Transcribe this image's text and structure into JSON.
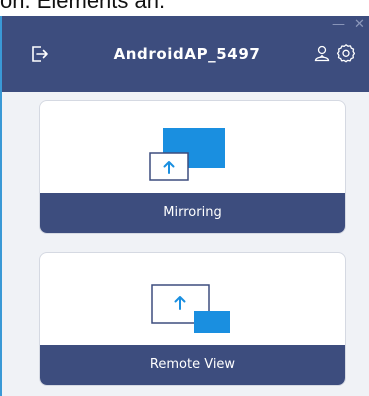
{
  "top_fragment": "on. Elements an.",
  "window_controls": {
    "minimize": "—",
    "close": "✕"
  },
  "header": {
    "title": "AndroidAP_5497",
    "icons": [
      "exit-icon",
      "user-icon",
      "gear-icon"
    ]
  },
  "cards": [
    {
      "id": "mirroring",
      "label": "Mirroring",
      "icon": "mirroring-icon"
    },
    {
      "id": "remote",
      "label": "Remote View",
      "icon": "remote-view-icon"
    }
  ],
  "colors": {
    "header_bg": "#3d4d7e",
    "accent": "#1a8fe0",
    "card_bg": "#ffffff",
    "page_bg": "#f0f2f6"
  }
}
